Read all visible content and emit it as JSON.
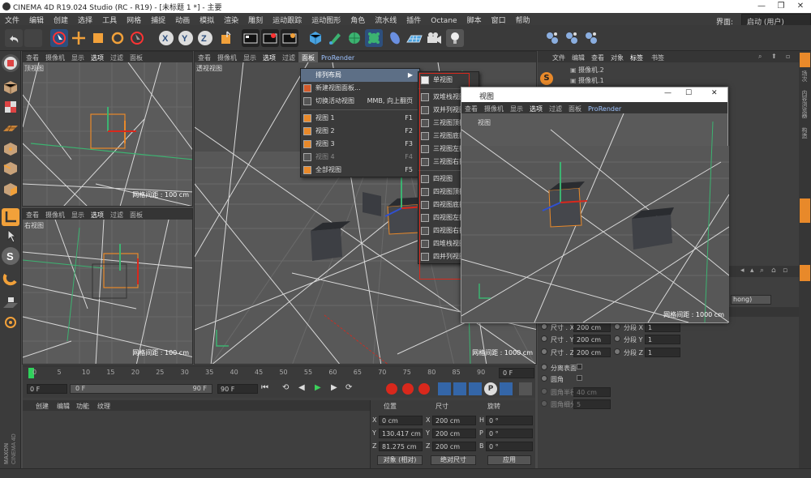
{
  "window": {
    "title": "CINEMA 4D R19.024 Studio (RC - R19) - [未标题 1 *] - 主要"
  },
  "menubar": {
    "items": [
      "文件",
      "编辑",
      "创建",
      "选择",
      "工具",
      "网格",
      "捕捉",
      "动画",
      "模拟",
      "渲染",
      "雕刻",
      "运动跟踪",
      "运动图形",
      "角色",
      "流水线",
      "插件",
      "Octane",
      "脚本",
      "窗口",
      "帮助"
    ],
    "layout_label": "界面:",
    "layout_value": "启动 (用户)"
  },
  "viewports": {
    "menu_items": [
      "查看",
      "摄像机",
      "显示",
      "选项",
      "过滤",
      "面板"
    ],
    "top": {
      "label": "顶视图",
      "grid": "网格间距 : 100 cm"
    },
    "right": {
      "label": "右视图",
      "grid": "网格间距 : 100 cm"
    },
    "perspective": {
      "label": "透视视图",
      "grid": "网格间距 : 1000 cm",
      "prorender": "ProRender"
    }
  },
  "panel_menu": {
    "items": [
      {
        "label": "排列布局",
        "shortcut": "",
        "has_sub": true
      },
      {
        "label": "新建视图面板...",
        "shortcut": ""
      },
      {
        "label": "切换活动视图",
        "shortcut": "MMB, 向上翻页"
      },
      {
        "label": "视图 1",
        "shortcut": "F1"
      },
      {
        "label": "视图 2",
        "shortcut": "F2"
      },
      {
        "label": "视图 3",
        "shortcut": "F3"
      },
      {
        "label": "视图 4",
        "shortcut": "F4"
      },
      {
        "label": "全部视图",
        "shortcut": "F5"
      }
    ]
  },
  "layout_submenu": {
    "items": [
      "单视图",
      "双堆栈视图",
      "双并列视图",
      "三视图顶拆分",
      "三视图底拆分",
      "三视图左拆分",
      "三视图右拆分",
      "四视图",
      "四视图顶拆分",
      "四视图底拆分",
      "四视图左拆分",
      "四视图右拆分",
      "四堆栈视图",
      "四并列视图"
    ]
  },
  "floating_view": {
    "title": "视图",
    "menu": [
      "查看",
      "摄像机",
      "显示",
      "选项",
      "过滤",
      "面板",
      "ProRender"
    ],
    "tag": "视图",
    "grid": "网格间距 : 1000 cm"
  },
  "object_manager": {
    "menu": [
      "文件",
      "编辑",
      "查看",
      "对象",
      "标签",
      "书签"
    ],
    "objects": [
      "摄像机.2",
      "摄像机.1"
    ],
    "side_tabs": [
      "对象",
      "场次",
      "内容浏览器",
      "构造"
    ],
    "phong_tag": "hong)"
  },
  "attributes": {
    "rows": [
      {
        "label": "尺寸 . X",
        "value": "200 cm",
        "seg_label": "分段 X",
        "seg_value": "1"
      },
      {
        "label": "尺寸 . Y",
        "value": "200 cm",
        "seg_label": "分段 Y",
        "seg_value": "1"
      },
      {
        "label": "尺寸 . Z",
        "value": "200 cm",
        "seg_label": "分段 Z",
        "seg_value": "1"
      }
    ],
    "separate_surfaces": "分离表面",
    "fillet": "圆角",
    "fillet_radius_label": "圆角半径",
    "fillet_radius_value": "40 cm",
    "fillet_subdiv_label": "圆角细分",
    "fillet_subdiv_value": "5",
    "side_tab": "属性"
  },
  "timeline": {
    "ticks": [
      "0",
      "5",
      "10",
      "15",
      "20",
      "25",
      "30",
      "35",
      "40",
      "45",
      "50",
      "55",
      "60",
      "65",
      "70",
      "75",
      "80",
      "85",
      "90"
    ],
    "frame_right": "0 F",
    "start_field": "0 F",
    "slider_start": "0 F",
    "slider_end": "90 F",
    "end_field": "90 F"
  },
  "material_panel": {
    "tabs": [
      "创建",
      "编辑",
      "功能",
      "纹理"
    ]
  },
  "coordinates": {
    "headers": [
      "位置",
      "尺寸",
      "旋转"
    ],
    "rows": [
      {
        "axis": "X",
        "pos": "0 cm",
        "size_axis": "X",
        "size": "200 cm",
        "rot_axis": "H",
        "rot": "0 °"
      },
      {
        "axis": "Y",
        "pos": "130.417 cm",
        "size_axis": "Y",
        "size": "200 cm",
        "rot_axis": "P",
        "rot": "0 °"
      },
      {
        "axis": "Z",
        "pos": "81.275 cm",
        "size_axis": "Z",
        "size": "200 cm",
        "rot_axis": "B",
        "rot": "0 °"
      }
    ],
    "mode_select": "对象 (相对)",
    "size_select": "绝对尺寸",
    "apply": "应用"
  },
  "branding": {
    "maxon": "MAXON",
    "c4d": "CINEMA 4D"
  },
  "colors": {
    "accent": "#5d6f86",
    "cube_select": "#e8892a",
    "red": "#d9281c"
  }
}
